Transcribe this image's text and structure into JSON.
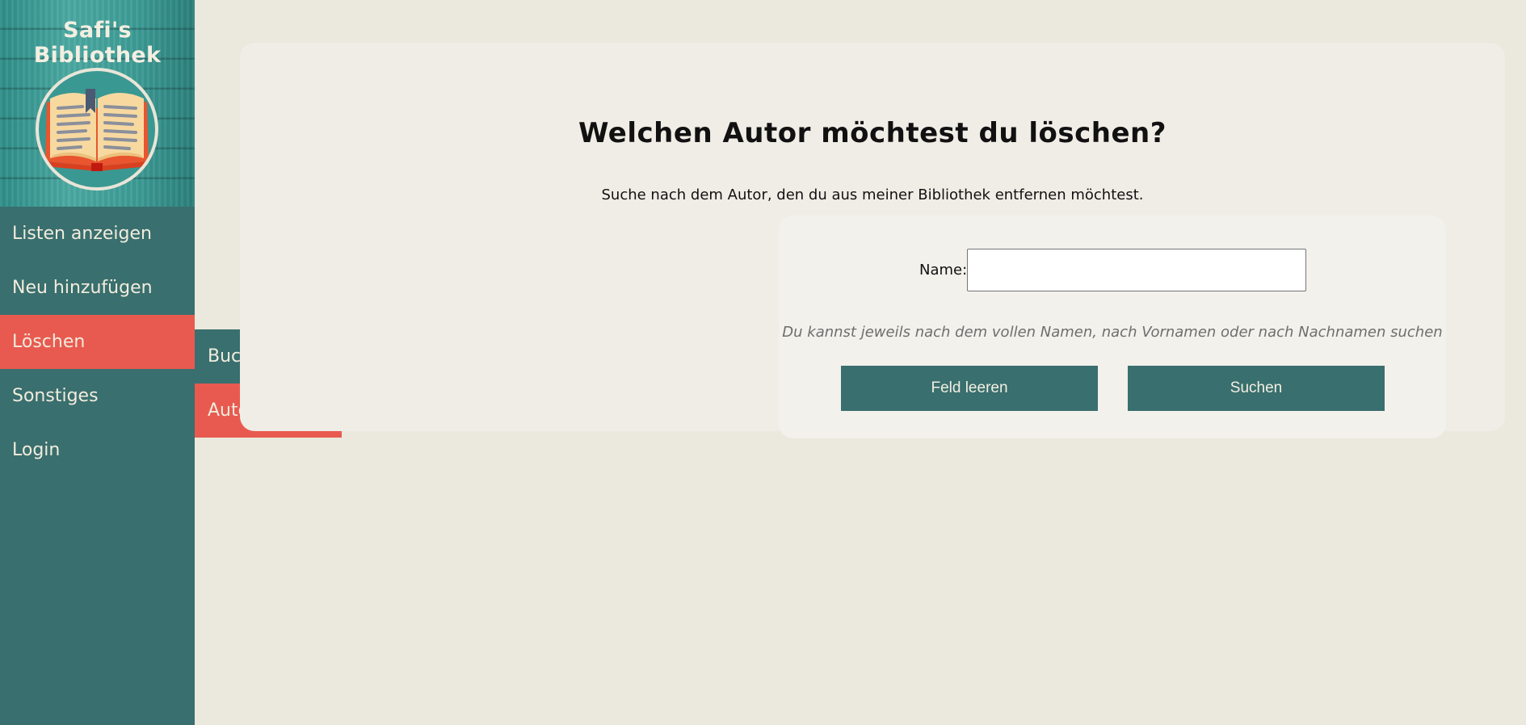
{
  "sidebar": {
    "title": "Safi's Bibliothek",
    "logo": "open-book-icon",
    "items": [
      {
        "label": "Listen anzeigen",
        "active": false
      },
      {
        "label": "Neu hinzufügen",
        "active": false
      },
      {
        "label": "Löschen",
        "active": true
      },
      {
        "label": "Sonstiges",
        "active": false
      },
      {
        "label": "Login",
        "active": false
      }
    ],
    "submenu": [
      {
        "label": "Buch löschen",
        "active": false
      },
      {
        "label": "Autor löschen",
        "active": true
      }
    ]
  },
  "main": {
    "heading": "Welchen Autor möchtest du löschen?",
    "description": "Suche nach dem Autor, den du aus meiner Bibliothek entfernen möchtest.",
    "form": {
      "name_label": "Name:",
      "name_value": "",
      "hint": "Du kannst jeweils nach dem vollen Namen, nach Vornamen oder nach Nachnamen suchen",
      "clear_label": "Feld leeren",
      "search_label": "Suchen"
    }
  },
  "colors": {
    "accent": "#396f6e",
    "active": "#e85a50",
    "background": "#ebe8dd",
    "card": "#f0ede6"
  }
}
